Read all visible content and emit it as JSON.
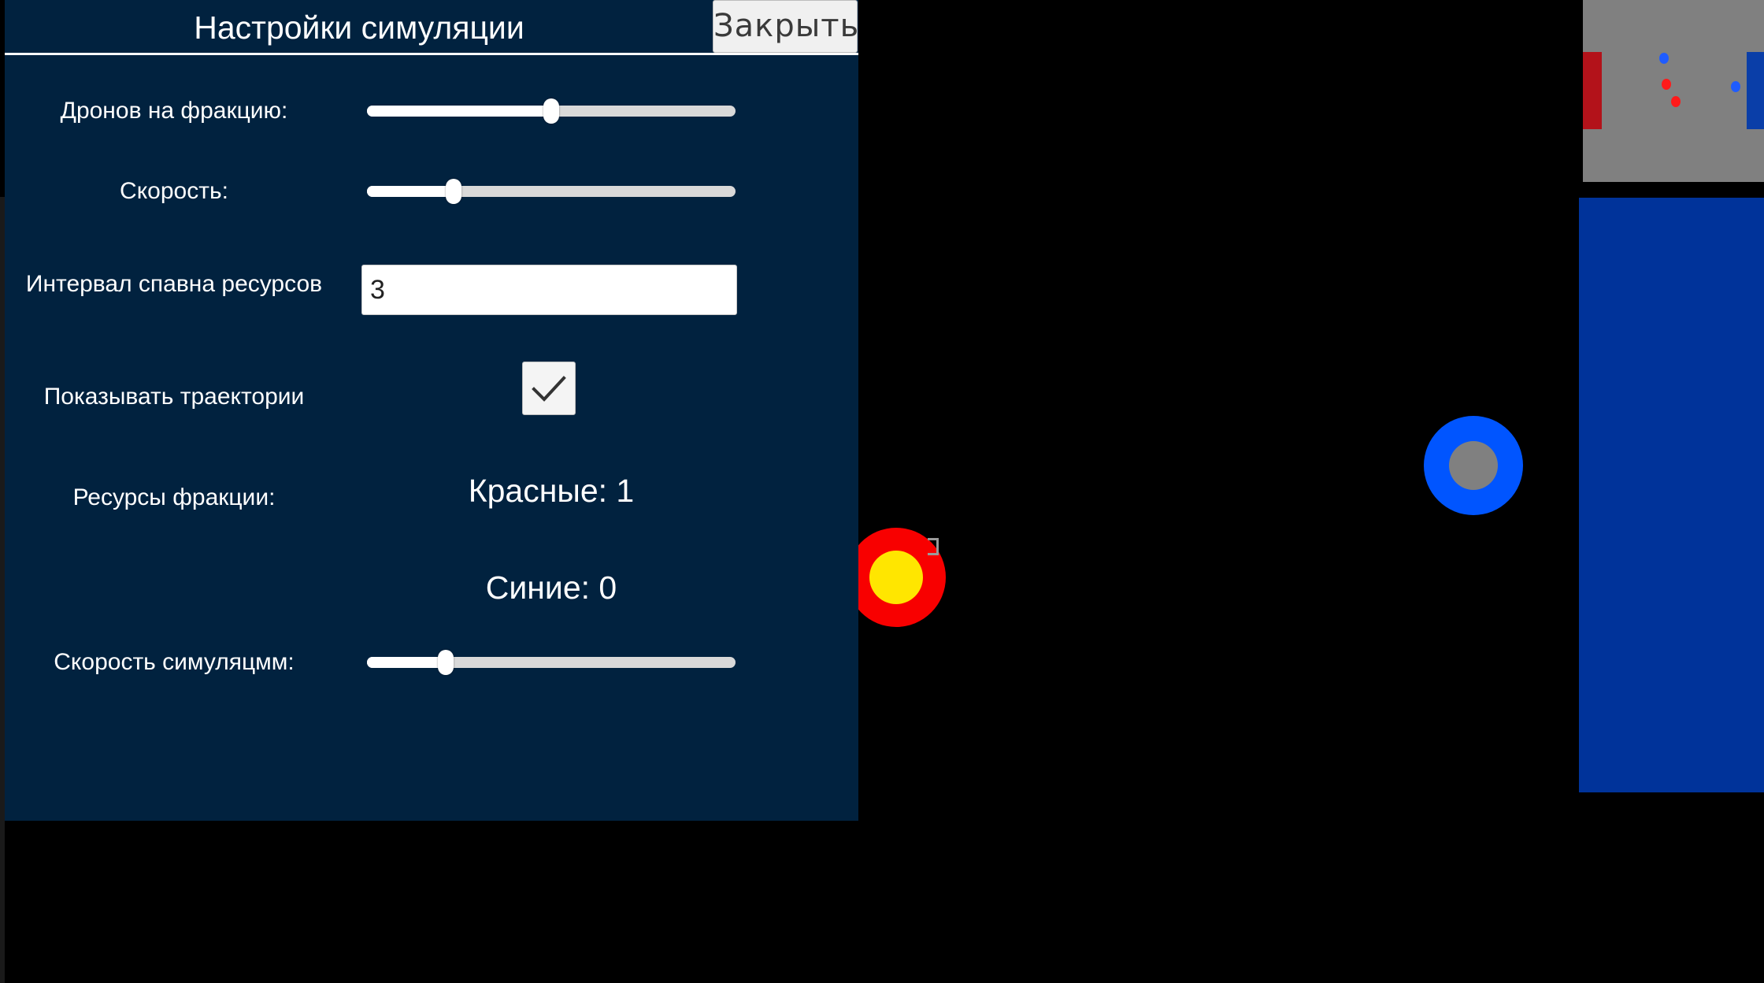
{
  "panel": {
    "title": "Настройки симуляции",
    "close_label": "Закрыть"
  },
  "settings": {
    "drones_label": "Дронов на фракцию:",
    "drones_slider_value": 0.5,
    "speed_label": "Скорость:",
    "speed_slider_value": 0.235,
    "spawn_interval_label": "Интервал спавна ресурсов",
    "spawn_interval_value": "3",
    "show_trajectories_label": "Показывать траектории",
    "show_trajectories_checked": true,
    "resources_label": "Ресурсы фракции:",
    "red_resources": "Красные: 1",
    "blue_resources": "Синие: 0",
    "sim_speed_label": "Скорость симуляцмм:",
    "sim_speed_slider_value": 0.213
  },
  "colors": {
    "panel_bg": "#01223f",
    "red_faction": "#f80000",
    "red_core": "#ffe600",
    "blue_faction": "#0055ff",
    "blue_core": "#808080",
    "blue_zone": "#00339a",
    "minimap_bg": "#808080"
  },
  "icons": {
    "checkbox": "checkmark-icon"
  }
}
